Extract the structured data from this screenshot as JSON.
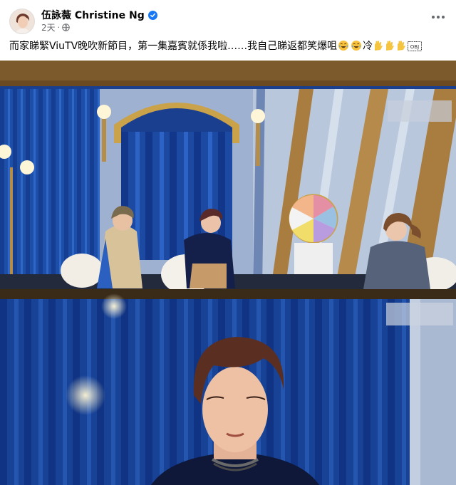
{
  "post": {
    "author": "伍詠薇 Christine Ng",
    "timestamp": "2天",
    "separator": "·",
    "audience_icon": "globe-icon",
    "verified_icon": "verified-badge-icon",
    "more_icon": "more-options-icon",
    "caption_text": "而家睇緊ViuTV晚吹新節目，第一集嘉賓就係我啦……我自己睇返都笑爆咀",
    "caption_word": "冷",
    "caption_emojis": [
      "tears-of-joy-emoji",
      "tears-of-joy-emoji",
      "raising-hands-emoji",
      "raising-hands-emoji",
      "raising-hands-emoji",
      "obj-symbol"
    ]
  },
  "photo": {
    "description_icon": "tv-screen-photo",
    "colors": {
      "curtain": "#1d4ea8",
      "curtain_dark": "#10307a",
      "wood_frame": "#7a5a2a",
      "gold_arch": "#c9a24a",
      "wall_stripe_light": "#b8c6dc",
      "wall_stripe_wood": "#a87d3f"
    }
  },
  "colors": {
    "accent": "#1877f2",
    "secondary_text": "#65676b"
  }
}
